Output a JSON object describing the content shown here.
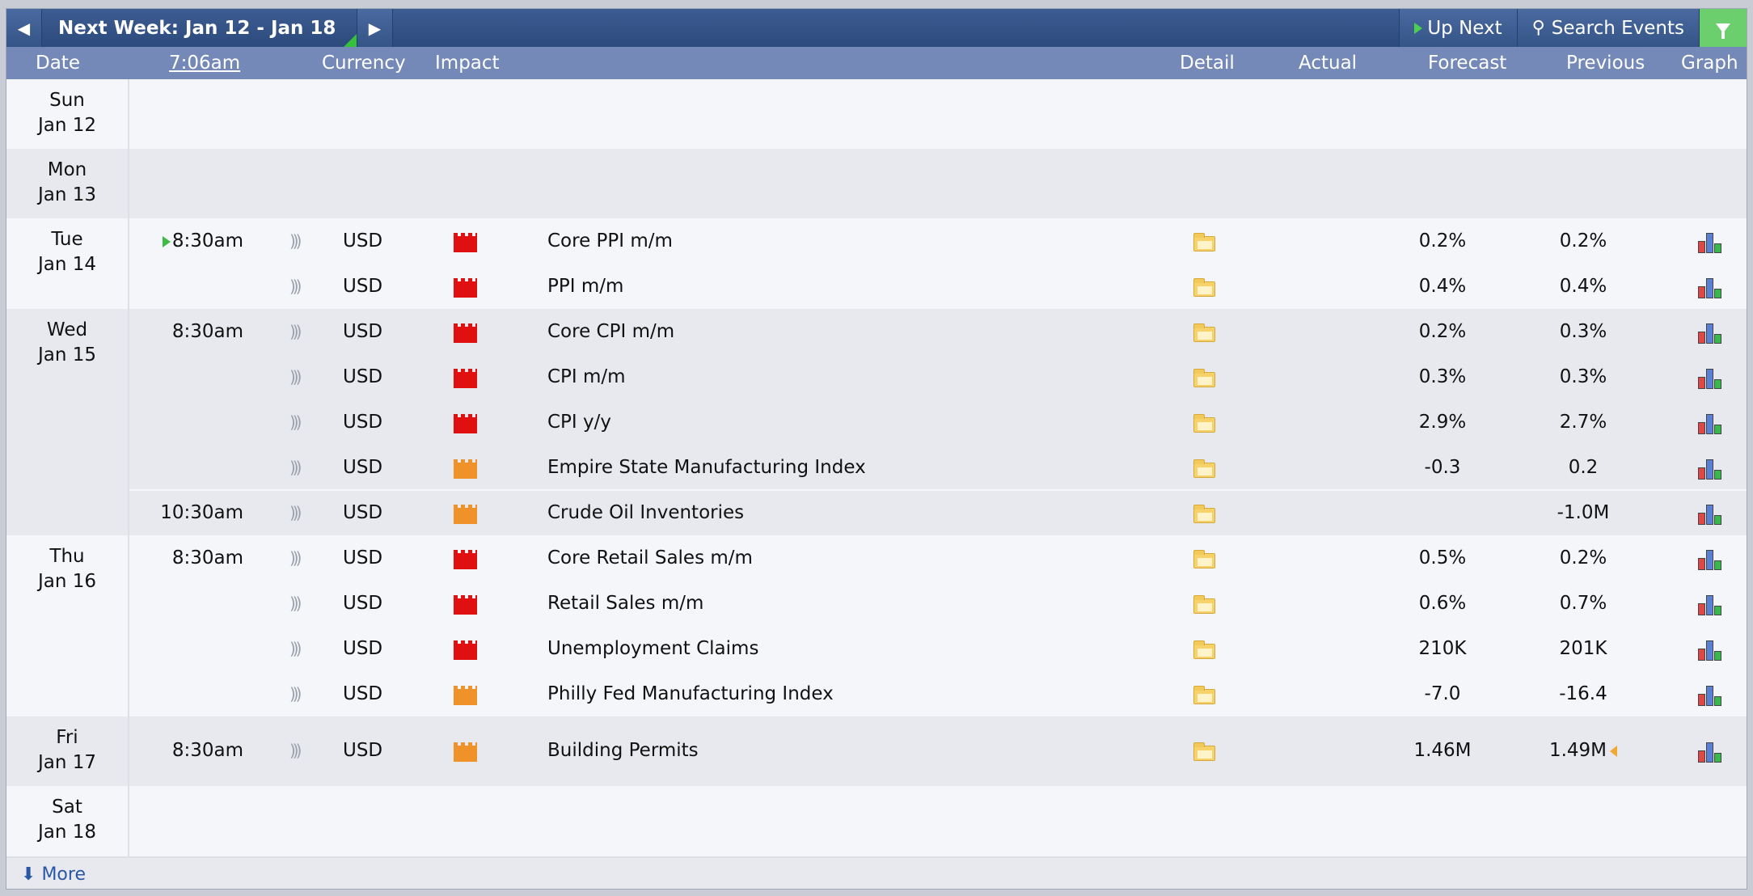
{
  "toolbar": {
    "prev_icon": "caret-left",
    "next_icon": "caret-right",
    "week_label": "Next Week: Jan 12 - Jan 18",
    "up_next_label": "Up Next",
    "search_label": "Search Events",
    "filter_icon": "funnel"
  },
  "header": {
    "date": "Date",
    "time": "7:06am",
    "currency": "Currency",
    "impact": "Impact",
    "detail": "Detail",
    "actual": "Actual",
    "forecast": "Forecast",
    "previous": "Previous",
    "graph": "Graph"
  },
  "days": [
    {
      "day": "Sun",
      "date": "Jan 12"
    },
    {
      "day": "Mon",
      "date": "Jan 13"
    },
    {
      "day": "Tue",
      "date": "Jan 14"
    },
    {
      "day": "Wed",
      "date": "Jan 15"
    },
    {
      "day": "Thu",
      "date": "Jan 16"
    },
    {
      "day": "Fri",
      "date": "Jan 17"
    },
    {
      "day": "Sat",
      "date": "Jan 18"
    }
  ],
  "events": [
    {
      "time": "8:30am",
      "currency": "USD",
      "impact": "high",
      "event": "Core PPI m/m",
      "actual": "",
      "forecast": "0.2%",
      "previous": "0.2%"
    },
    {
      "time": "",
      "currency": "USD",
      "impact": "high",
      "event": "PPI m/m",
      "actual": "",
      "forecast": "0.4%",
      "previous": "0.4%"
    },
    {
      "time": "8:30am",
      "currency": "USD",
      "impact": "high",
      "event": "Core CPI m/m",
      "actual": "",
      "forecast": "0.2%",
      "previous": "0.3%"
    },
    {
      "time": "",
      "currency": "USD",
      "impact": "high",
      "event": "CPI m/m",
      "actual": "",
      "forecast": "0.3%",
      "previous": "0.3%"
    },
    {
      "time": "",
      "currency": "USD",
      "impact": "high",
      "event": "CPI y/y",
      "actual": "",
      "forecast": "2.9%",
      "previous": "2.7%"
    },
    {
      "time": "",
      "currency": "USD",
      "impact": "medium",
      "event": "Empire State Manufacturing Index",
      "actual": "",
      "forecast": "-0.3",
      "previous": "0.2"
    },
    {
      "time": "10:30am",
      "currency": "USD",
      "impact": "medium",
      "event": "Crude Oil Inventories",
      "actual": "",
      "forecast": "",
      "previous": "-1.0M"
    },
    {
      "time": "8:30am",
      "currency": "USD",
      "impact": "high",
      "event": "Core Retail Sales m/m",
      "actual": "",
      "forecast": "0.5%",
      "previous": "0.2%"
    },
    {
      "time": "",
      "currency": "USD",
      "impact": "high",
      "event": "Retail Sales m/m",
      "actual": "",
      "forecast": "0.6%",
      "previous": "0.7%"
    },
    {
      "time": "",
      "currency": "USD",
      "impact": "high",
      "event": "Unemployment Claims",
      "actual": "",
      "forecast": "210K",
      "previous": "201K"
    },
    {
      "time": "",
      "currency": "USD",
      "impact": "medium",
      "event": "Philly Fed Manufacturing Index",
      "actual": "",
      "forecast": "-7.0",
      "previous": "-16.4"
    },
    {
      "time": "8:30am",
      "currency": "USD",
      "impact": "medium",
      "event": "Building Permits",
      "actual": "",
      "forecast": "1.46M",
      "previous": "1.49M"
    }
  ],
  "colors": {
    "high_impact": "#e01010",
    "medium_impact": "#f0922a",
    "header_bg": "#7489b8",
    "topbar_bg": "#2c4a7c",
    "filter_bg": "#6ccf6d",
    "link": "#2a56a6"
  },
  "footer": {
    "more_label": "More"
  }
}
